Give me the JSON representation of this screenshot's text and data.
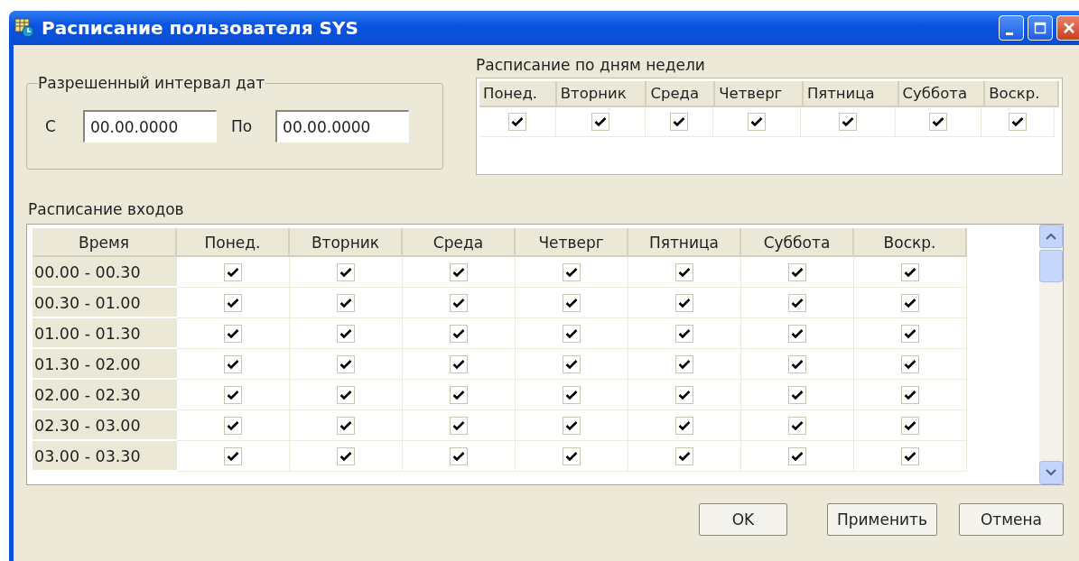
{
  "window": {
    "title": "Расписание пользователя SYS"
  },
  "date_range": {
    "label": "Разрешенный интервал дат",
    "from_label": "С",
    "from_value": "00.00.0000",
    "to_label": "По",
    "to_value": "00.00.0000"
  },
  "weekdays": {
    "label": "Расписание по дням недели",
    "days": [
      {
        "label": "Понед.",
        "checked": true
      },
      {
        "label": "Вторник",
        "checked": true
      },
      {
        "label": "Среда",
        "checked": true
      },
      {
        "label": "Четверг",
        "checked": true
      },
      {
        "label": "Пятница",
        "checked": true
      },
      {
        "label": "Суббота",
        "checked": true
      },
      {
        "label": "Воскр.",
        "checked": true
      }
    ]
  },
  "schedule": {
    "label": "Расписание входов",
    "columns": [
      "Время",
      "Понед.",
      "Вторник",
      "Среда",
      "Четверг",
      "Пятница",
      "Суббота",
      "Воскр."
    ],
    "rows": [
      {
        "time": "00.00 - 00.30",
        "days": [
          {
            "checked": true
          },
          {
            "checked": true
          },
          {
            "checked": true
          },
          {
            "checked": true
          },
          {
            "checked": true
          },
          {
            "checked": true
          },
          {
            "checked": true
          }
        ]
      },
      {
        "time": "00.30 - 01.00",
        "days": [
          {
            "checked": true
          },
          {
            "checked": true
          },
          {
            "checked": true
          },
          {
            "checked": true
          },
          {
            "checked": true
          },
          {
            "checked": true
          },
          {
            "checked": true
          }
        ]
      },
      {
        "time": "01.00 - 01.30",
        "days": [
          {
            "checked": true
          },
          {
            "checked": true
          },
          {
            "checked": true
          },
          {
            "checked": true
          },
          {
            "checked": true
          },
          {
            "checked": true
          },
          {
            "checked": true
          }
        ]
      },
      {
        "time": "01.30 - 02.00",
        "days": [
          {
            "checked": true
          },
          {
            "checked": true
          },
          {
            "checked": true
          },
          {
            "checked": true
          },
          {
            "checked": true
          },
          {
            "checked": true
          },
          {
            "checked": true
          }
        ]
      },
      {
        "time": "02.00 - 02.30",
        "days": [
          {
            "checked": true
          },
          {
            "checked": true
          },
          {
            "checked": true
          },
          {
            "checked": true
          },
          {
            "checked": true
          },
          {
            "checked": true
          },
          {
            "checked": true
          }
        ]
      },
      {
        "time": "02.30 - 03.00",
        "days": [
          {
            "checked": true
          },
          {
            "checked": true
          },
          {
            "checked": true
          },
          {
            "checked": true
          },
          {
            "checked": true
          },
          {
            "checked": true
          },
          {
            "checked": true
          }
        ]
      },
      {
        "time": "03.00 - 03.30",
        "days": [
          {
            "checked": true
          },
          {
            "checked": true
          },
          {
            "checked": true
          },
          {
            "checked": true
          },
          {
            "checked": true
          },
          {
            "checked": true
          },
          {
            "checked": true
          }
        ]
      }
    ]
  },
  "buttons": [
    "OK",
    "Применить",
    "Отмена"
  ]
}
